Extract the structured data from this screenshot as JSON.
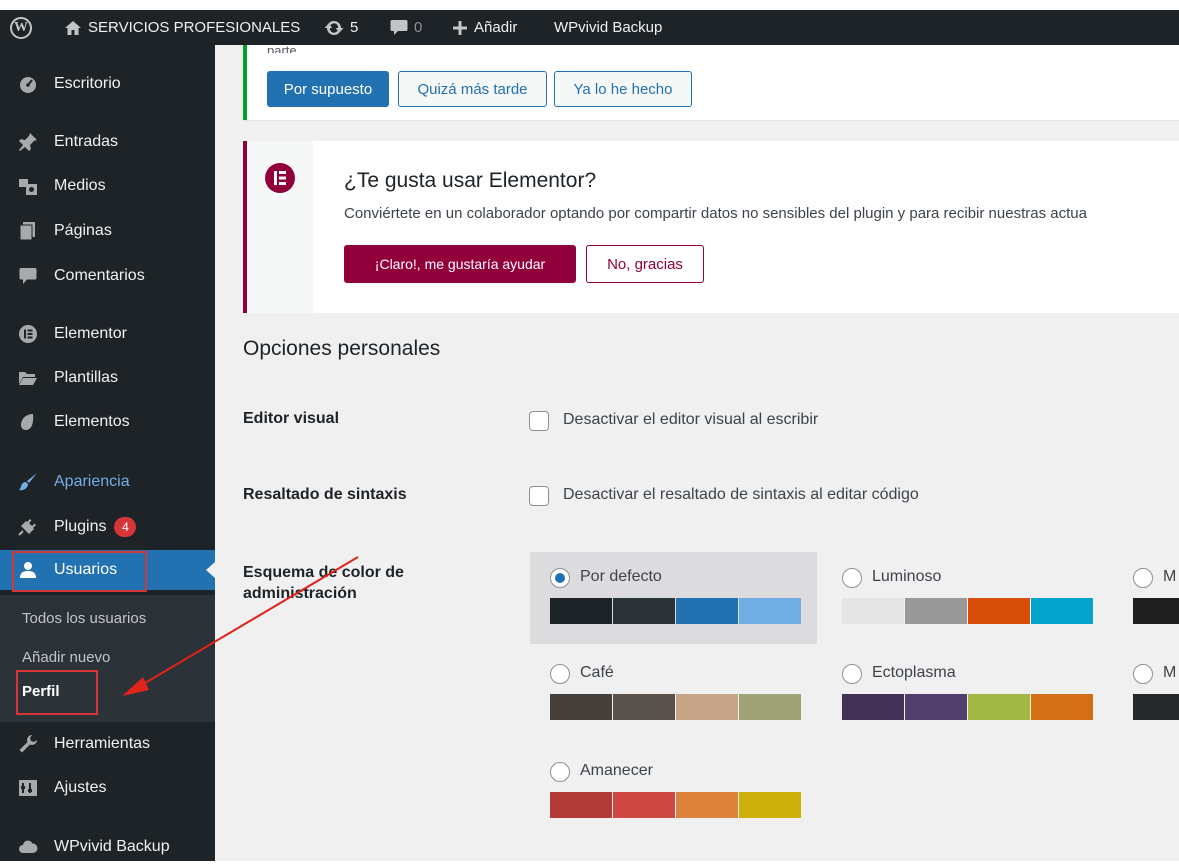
{
  "admin_bar": {
    "site_name": "SERVICIOS PROFESIONALES",
    "updates_count": "5",
    "comments_count": "0",
    "new_label": "Añadir",
    "plugin_label": "WPvivid Backup"
  },
  "sidebar": {
    "items": [
      {
        "label": "Escritorio",
        "icon": "dashboard-icon"
      },
      {
        "label": "Entradas",
        "icon": "pin-icon"
      },
      {
        "label": "Medios",
        "icon": "media-icon"
      },
      {
        "label": "Páginas",
        "icon": "page-icon"
      },
      {
        "label": "Comentarios",
        "icon": "comment-icon"
      },
      {
        "label": "Elementor",
        "icon": "elementor-icon"
      },
      {
        "label": "Plantillas",
        "icon": "folder-icon"
      },
      {
        "label": "Elementos",
        "icon": "elements-icon"
      },
      {
        "label": "Apariencia",
        "icon": "brush-icon"
      },
      {
        "label": "Plugins",
        "icon": "plugin-icon",
        "badge": "4"
      },
      {
        "label": "Usuarios",
        "icon": "users-icon"
      },
      {
        "label": "Herramientas",
        "icon": "wrench-icon"
      },
      {
        "label": "Ajustes",
        "icon": "settings-icon"
      },
      {
        "label": "WPvivid Backup",
        "icon": "cloud-icon"
      }
    ],
    "submenu": [
      {
        "label": "Todos los usuarios"
      },
      {
        "label": "Añadir nuevo"
      },
      {
        "label": "Perfil"
      }
    ]
  },
  "notice_review": {
    "partial_text": "parte.",
    "btn_yes": "Por supuesto",
    "btn_later": "Quizá más tarde",
    "btn_done": "Ya lo he hecho"
  },
  "notice_elementor": {
    "title": "¿Te gusta usar Elementor?",
    "text": "Conviértete en un colaborador optando por compartir datos no sensibles del plugin y para recibir nuestras actua",
    "btn_yes": "¡Claro!, me gustaría ayudar",
    "btn_no": "No, gracias"
  },
  "personal_options": {
    "heading": "Opciones personales",
    "visual_editor_label": "Editor visual",
    "visual_editor_text": "Desactivar el editor visual al escribir",
    "syntax_label": "Resaltado de sintaxis",
    "syntax_text": "Desactivar el resaltado de sintaxis al editar código",
    "color_scheme_label": "Esquema de color de administración",
    "schemes": [
      {
        "name": "Por defecto",
        "selected": true,
        "colors": [
          "#1d2327",
          "#2c3338",
          "#2271b1",
          "#72aee6"
        ]
      },
      {
        "name": "Luminoso",
        "selected": false,
        "colors": [
          "#e5e5e5",
          "#999999",
          "#d64e07",
          "#04a4cc"
        ]
      },
      {
        "name": "M",
        "selected": false,
        "colors": [
          "#1e1e1e"
        ]
      },
      {
        "name": "Café",
        "selected": false,
        "colors": [
          "#46403c",
          "#59524c",
          "#c7a589",
          "#9ea476"
        ]
      },
      {
        "name": "Ectoplasma",
        "selected": false,
        "colors": [
          "#413256",
          "#523f6d",
          "#a3b745",
          "#d46f15"
        ]
      },
      {
        "name": "M",
        "selected": false,
        "colors": [
          "#25282b"
        ]
      },
      {
        "name": "Amanecer",
        "selected": false,
        "colors": [
          "#b43c38",
          "#cf4944",
          "#dd823b",
          "#ccaf0b"
        ]
      }
    ]
  },
  "colors": {
    "accent": "#2271b1",
    "annotation": "#d63638",
    "elementor": "#92003b"
  }
}
